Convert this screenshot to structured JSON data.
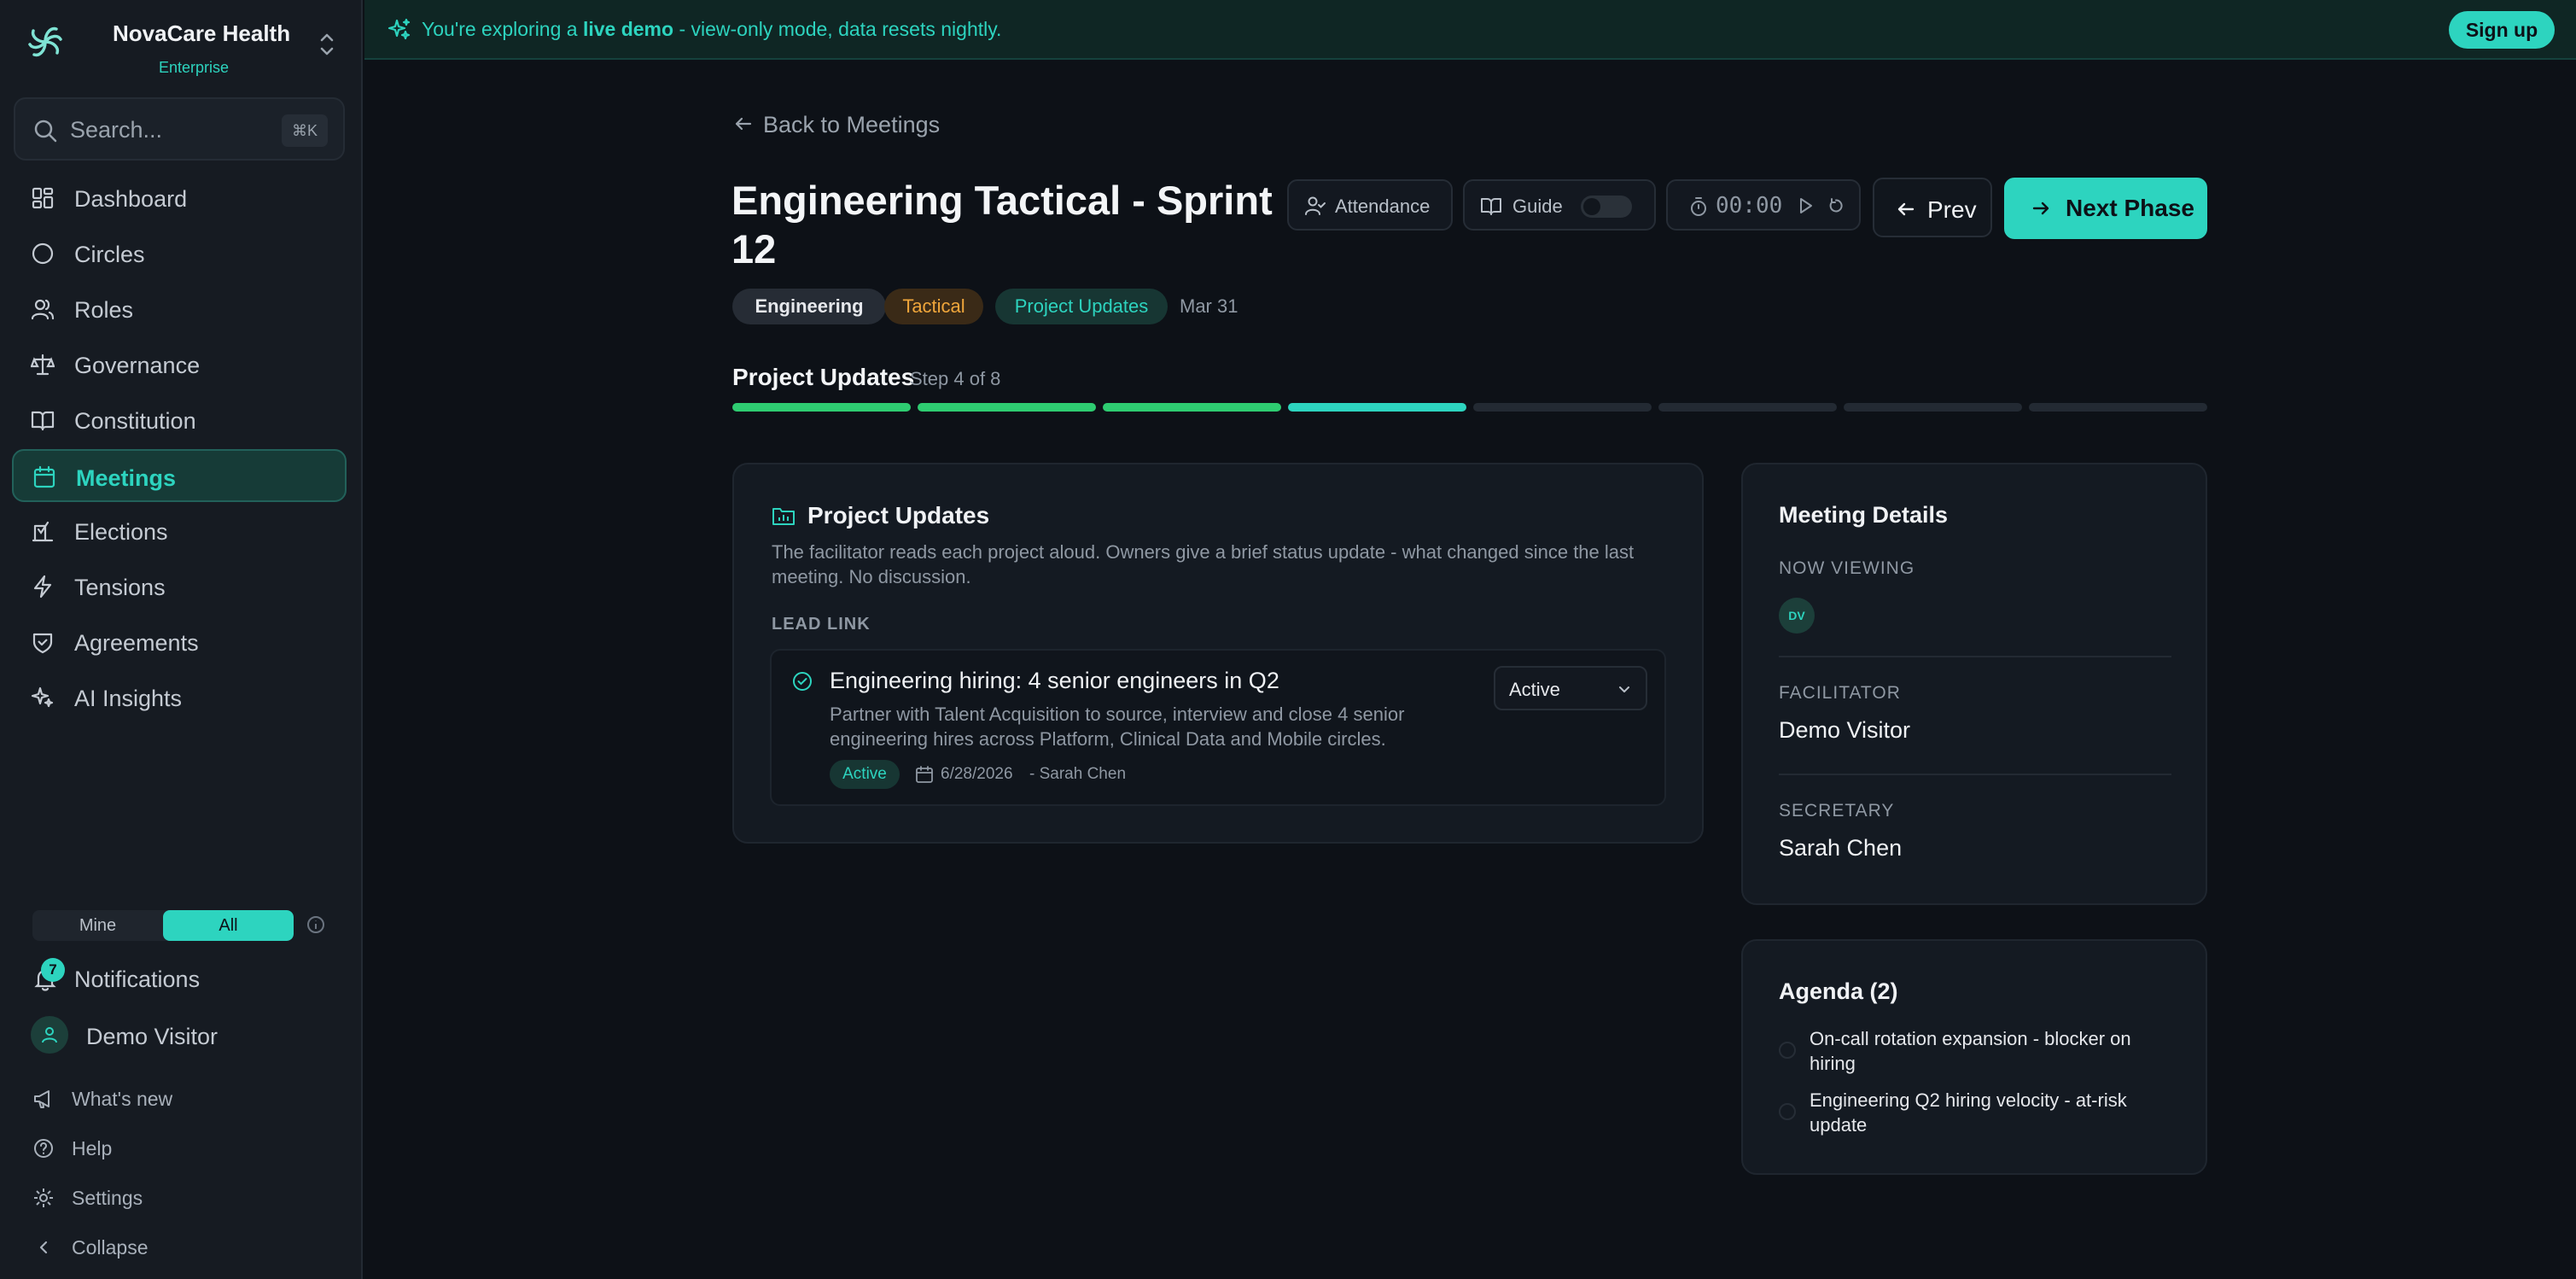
{
  "app": {
    "brand_name": "NovaCare Health",
    "brand_tier": "Enterprise"
  },
  "search": {
    "placeholder": "Search...",
    "shortcut": "⌘K"
  },
  "sidebar": {
    "items": [
      {
        "label": "Dashboard",
        "icon": "dashboard-icon"
      },
      {
        "label": "Circles",
        "icon": "circle-icon"
      },
      {
        "label": "Roles",
        "icon": "users-icon"
      },
      {
        "label": "Governance",
        "icon": "scale-icon"
      },
      {
        "label": "Constitution",
        "icon": "book-icon"
      },
      {
        "label": "Meetings",
        "icon": "calendar-icon",
        "active": true
      },
      {
        "label": "Elections",
        "icon": "ballot-icon"
      },
      {
        "label": "Tensions",
        "icon": "bolt-icon"
      },
      {
        "label": "Agreements",
        "icon": "handshake-icon"
      },
      {
        "label": "AI Insights",
        "icon": "sparkle-icon"
      }
    ],
    "scope": {
      "mine": "Mine",
      "all": "All",
      "selected": "All"
    },
    "notifications": {
      "label": "Notifications",
      "count": "7"
    },
    "user": {
      "name": "Demo Visitor"
    },
    "footer": {
      "whats_new": "What's new",
      "help": "Help",
      "settings": "Settings",
      "collapse": "Collapse"
    }
  },
  "banner": {
    "prefix": "You're exploring a ",
    "emphasis": "live demo",
    "suffix": " - view-only mode, data resets nightly.",
    "signup": "Sign up"
  },
  "meeting": {
    "back_label": "Back to Meetings",
    "title": "Engineering Tactical - Sprint 12",
    "tags": {
      "circle": "Engineering",
      "type": "Tactical",
      "phase": "Project Updates",
      "date": "Mar 31"
    },
    "controls": {
      "attendance": "Attendance",
      "guide": "Guide",
      "guide_on": false,
      "timer": "00:00",
      "prev": "Prev",
      "next": "Next Phase"
    },
    "step": {
      "name": "Project Updates",
      "count_label": "Step 4 of 8",
      "current": 4,
      "total": 8
    }
  },
  "phase_card": {
    "title": "Project Updates",
    "description": "The facilitator reads each project aloud. Owners give a brief status update - what changed since the last meeting. No discussion.",
    "section_label": "LEAD LINK",
    "project": {
      "name": "Engineering hiring: 4 senior engineers in Q2",
      "description": "Partner with Talent Acquisition to source, interview and close 4 senior engineering hires across Platform, Clinical Data and Mobile circles.",
      "status": "Active",
      "due": "6/28/2026",
      "owner": "- Sarah Chen",
      "status_select": "Active"
    }
  },
  "details": {
    "title": "Meeting Details",
    "now_viewing_label": "NOW VIEWING",
    "viewer_initials": "DV",
    "facilitator_label": "FACILITATOR",
    "facilitator": "Demo Visitor",
    "secretary_label": "SECRETARY",
    "secretary": "Sarah Chen"
  },
  "agenda": {
    "title": "Agenda (2)",
    "items": [
      "On-call rotation expansion - blocker on hiring",
      "Engineering Q2 hiring velocity - at-risk update"
    ]
  },
  "colors": {
    "accent": "#2dd4bf",
    "progress_done": "#2ecc71",
    "tactical": "#f0a63b",
    "background": "#0d1117"
  }
}
